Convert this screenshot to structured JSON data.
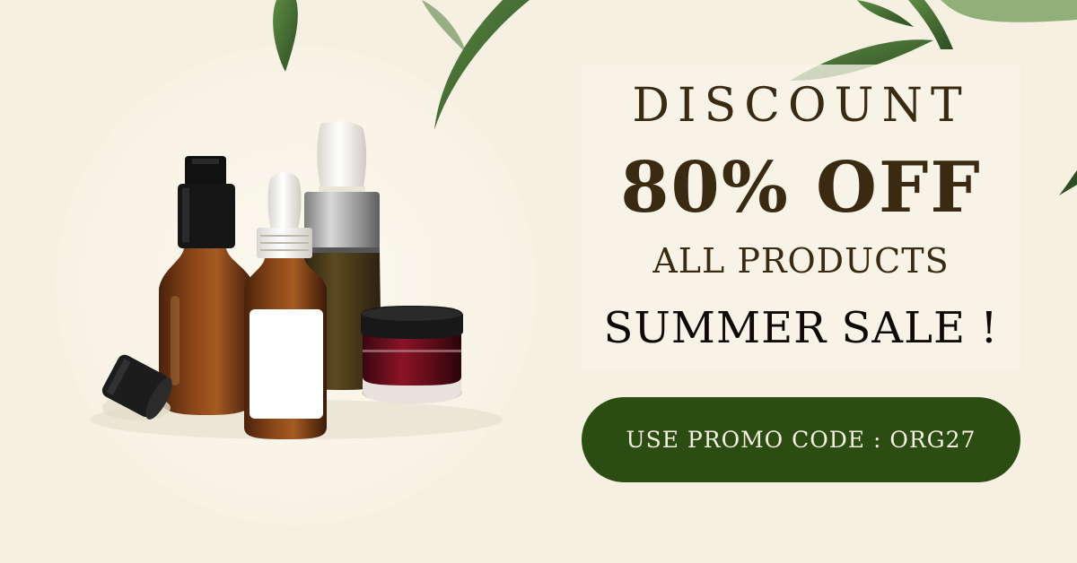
{
  "banner": {
    "headline": "DISCOUNT",
    "offer": "80% OFF",
    "scope": "ALL PRODUCTS",
    "event": "SUMMER SALE !",
    "promo_label": "USE PROMO CODE : ORG27"
  },
  "colors": {
    "background": "#f5f0e1",
    "headline_text": "#3a2a12",
    "event_text": "#0d0a08",
    "promo_button": "#2c4d12",
    "promo_text": "#f4f0e4",
    "leaf": "#3f6b33"
  },
  "visuals": [
    "leaf-decoration",
    "amber-pump-bottle",
    "amber-dropper-bottle",
    "silver-dropper-bottle",
    "red-cosmetic-jar",
    "bottle-cap"
  ]
}
